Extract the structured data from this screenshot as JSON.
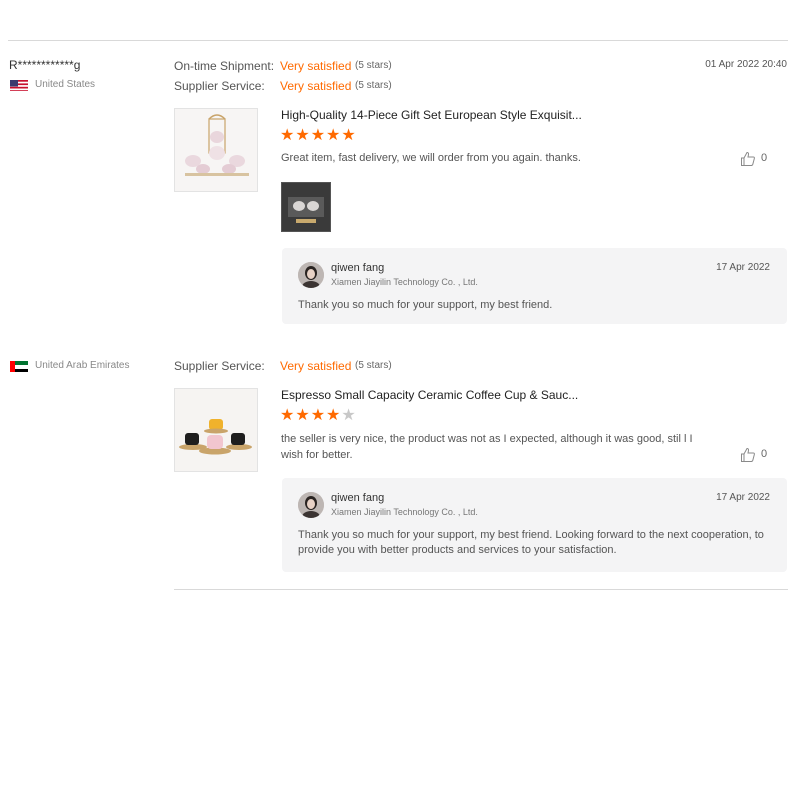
{
  "reviews": [
    {
      "user": "R************g",
      "country": "United States",
      "flag_icon": "us-flag-icon",
      "ratings": [
        {
          "label": "On-time Shipment:",
          "value": "Very satisfied",
          "stars": "(5 stars)"
        },
        {
          "label": "Supplier Service:",
          "value": "Very satisfied",
          "stars": "(5 stars)"
        }
      ],
      "date": "01 Apr 2022 20:40",
      "product_title": "High-Quality 14-Piece Gift Set European Style Exquisit...",
      "star_rating": 5,
      "comment": "Great item, fast delivery, we will order from you again. thanks.",
      "likes": "0",
      "reply": {
        "name": "qiwen fang",
        "company": "Xiamen Jiayilin Technology Co. , Ltd.",
        "date": "17 Apr 2022",
        "text": "Thank you so much for your support, my best friend."
      }
    },
    {
      "user": "",
      "country": "United Arab Emirates",
      "flag_icon": "uae-flag-icon",
      "ratings": [
        {
          "label": "Supplier Service:",
          "value": "Very satisfied",
          "stars": "(5 stars)"
        }
      ],
      "date": "",
      "product_title": "Espresso Small Capacity Ceramic Coffee Cup & Sauc...",
      "star_rating": 4,
      "comment": "the seller is very nice, the product was not as I expected, although it was good, stil l I wish for better.",
      "likes": "0",
      "reply": {
        "name": "qiwen fang",
        "company": "Xiamen Jiayilin Technology Co. , Ltd.",
        "date": "17 Apr 2022",
        "text": "Thank you so much for your support, my best friend. Looking forward to the next cooperation, to provide you with better products and services to your satisfaction."
      }
    }
  ],
  "colors": {
    "accent": "#ff6a00",
    "reply_bg": "#f4f4f5",
    "divider": "#d9d9d9",
    "star_off": "#c8c8c8"
  }
}
